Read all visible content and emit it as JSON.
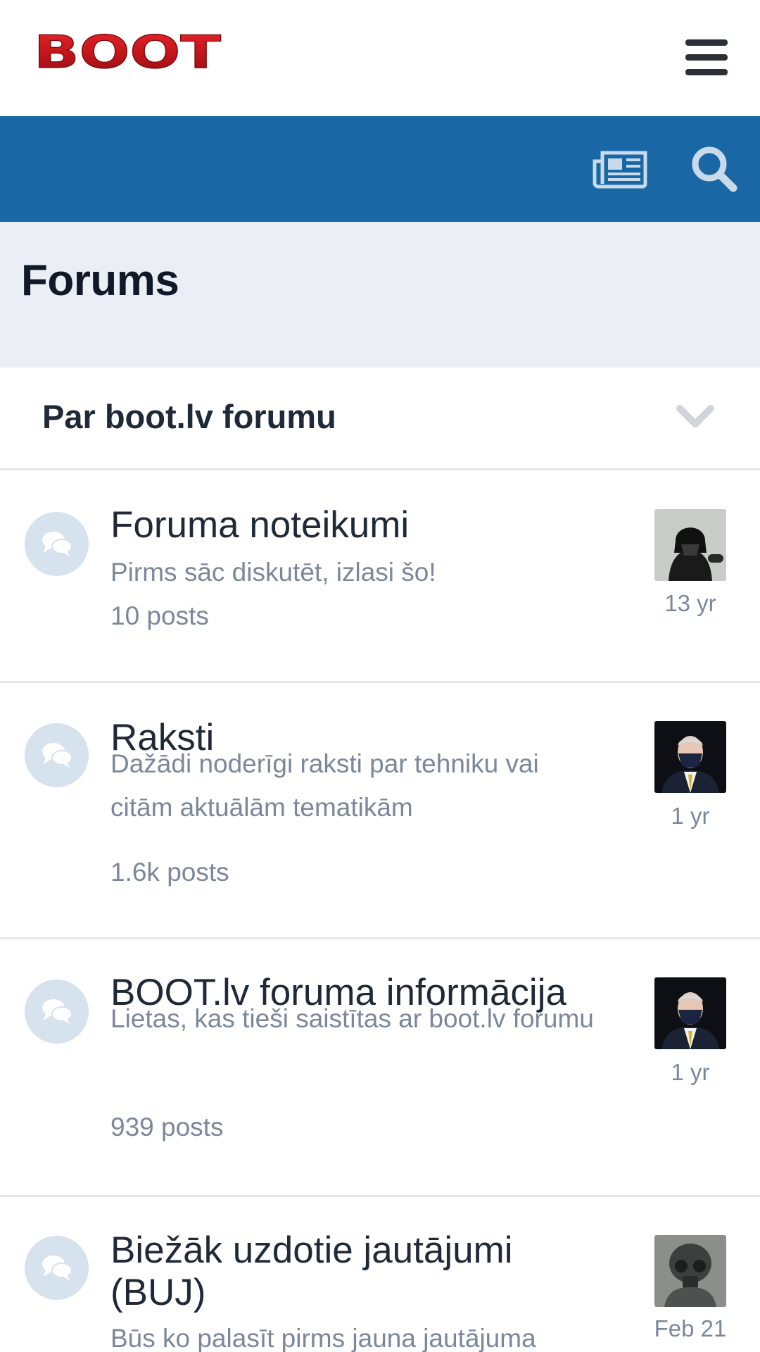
{
  "header": {
    "logo_text": "BOOT",
    "menu_icon": "hamburger-menu-icon"
  },
  "navbar": {
    "icons": [
      "newspaper-icon",
      "search-icon"
    ],
    "color": "#1967a4"
  },
  "page": {
    "title": "Forums"
  },
  "category": {
    "title": "Par boot.lv forumu",
    "toggle_icon": "chevron-down-icon"
  },
  "forums": [
    {
      "title": "Foruma noteikumi",
      "description": "Pirms sāc diskutēt, izlasi šo!",
      "posts": "10 posts",
      "last_post": "13 yr",
      "avatar": "darth-vader-avatar"
    },
    {
      "title": "Raksti",
      "description": "Dažādi noderīgi raksti par tehniku vai citām aktuālām tematikām",
      "posts": "1.6k posts",
      "last_post": "1 yr",
      "avatar": "man-in-mask-avatar"
    },
    {
      "title": "BOOT.lv foruma informācija",
      "description": "Lietas, kas tieši saistītas ar boot.lv forumu",
      "posts": "939 posts",
      "last_post": "1 yr",
      "avatar": "man-in-mask-avatar"
    },
    {
      "title": "Biežāk uzdotie jautājumi (BUJ)",
      "description": "Būs ko palasīt pirms jauna jautājuma",
      "posts": "",
      "last_post": "Feb 21",
      "avatar": "power-armor-avatar"
    }
  ],
  "colors": {
    "accent": "#1967a4",
    "header_bg": "#ebeef5",
    "muted_text": "#7c879b",
    "icon_bg": "#d6e2ee",
    "logo_red": "#c4161c"
  }
}
